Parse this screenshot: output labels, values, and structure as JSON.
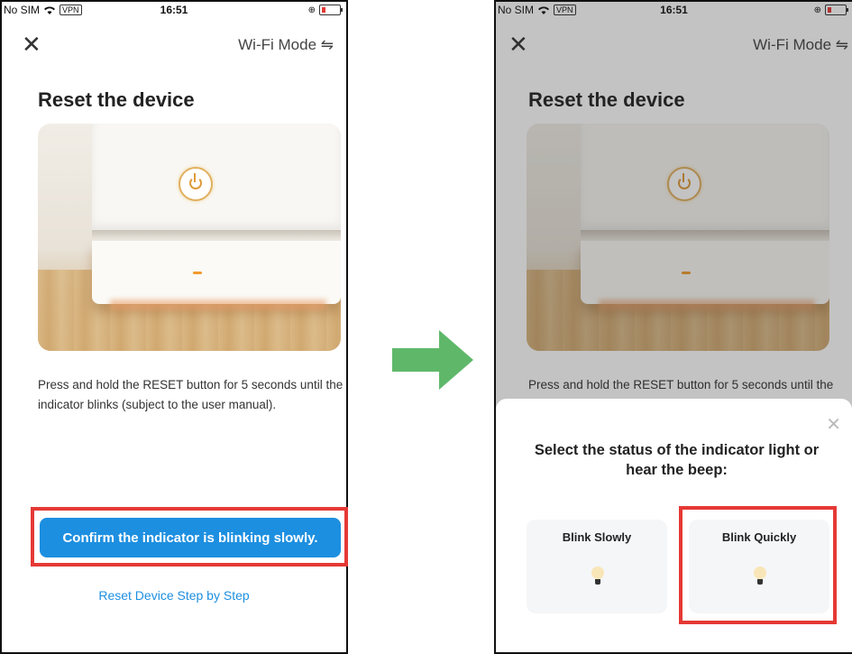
{
  "status": {
    "carrier": "No SIM",
    "vpn": "VPN",
    "time": "16:51"
  },
  "header": {
    "wifi_mode": "Wi-Fi Mode ⇋"
  },
  "page": {
    "title": "Reset the device",
    "description": "Press and hold the RESET button for 5 seconds until the indicator blinks (subject to the user manual).",
    "description_partial": "Press and hold the RESET button for 5 seconds until the"
  },
  "buttons": {
    "confirm": "Confirm the indicator is blinking slowly.",
    "step_by_step": "Reset Device Step by Step"
  },
  "sheet": {
    "title": "Select the status of the indicator light or hear the beep:",
    "options": [
      {
        "label": "Blink Slowly"
      },
      {
        "label": "Blink Quickly"
      }
    ]
  },
  "colors": {
    "accent": "#1d8fe0",
    "highlight": "#e53935",
    "arrow": "#5fb86a"
  }
}
